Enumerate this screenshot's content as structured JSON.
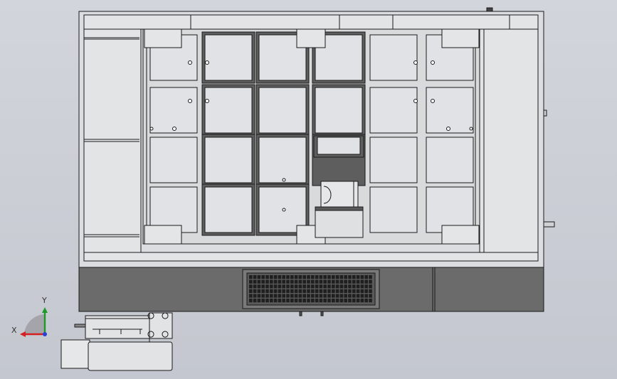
{
  "viewport": {
    "background_top": "#d3d5dc",
    "background_bottom": "#c4c7cf"
  },
  "triad": {
    "x_label": "X",
    "y_label": "Y",
    "x_color": "#d42020",
    "y_color": "#1f9a2a",
    "z_color": "#2a3fd4"
  },
  "colors": {
    "panel": "#e1e2e5",
    "frame": "#d9dadc",
    "line": "#1a1a1a",
    "dark_base": "#6b6b6b",
    "pocket_shade": "#5e5e5e"
  },
  "grid": {
    "rows": 4,
    "cols": 6
  }
}
